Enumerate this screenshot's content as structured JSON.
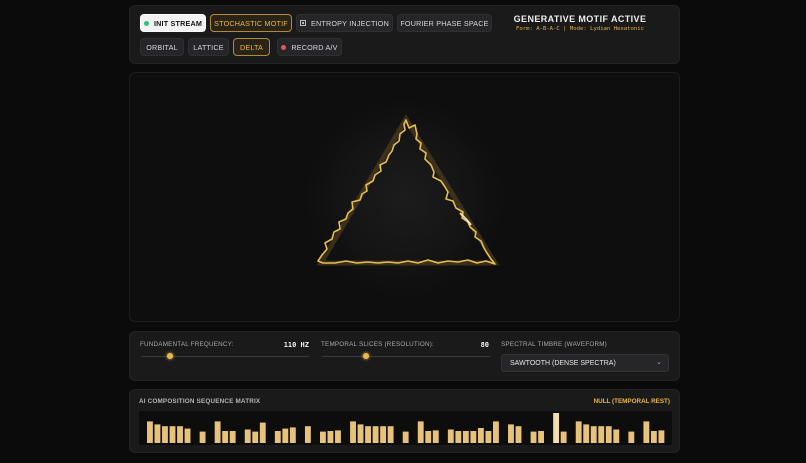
{
  "toolbar": {
    "row1": [
      {
        "label": "INIT STREAM",
        "style": "primary",
        "icon": "status-dot-icon"
      },
      {
        "label": "STOCHASTIC MOTIF",
        "style": "gold"
      },
      {
        "label": "ENTROPY INJECTION",
        "style": "normal",
        "icon": "square-icon"
      },
      {
        "label": "FOURIER PHASE SPACE",
        "style": "normal"
      }
    ],
    "row2": [
      {
        "label": "ORBITAL",
        "style": "normal"
      },
      {
        "label": "LATTICE",
        "style": "normal"
      },
      {
        "label": "DELTA",
        "style": "gold"
      },
      {
        "label": "RECORD A/V",
        "style": "normal",
        "icon": "record-dot-icon"
      }
    ],
    "status_title": "GENERATIVE MOTIF ACTIVE",
    "status_sub": "Form: A-B-A-C | Mode: Lydian Hexatonic"
  },
  "controls": {
    "frequency": {
      "label": "FUNDAMENTAL FREQUENCY:",
      "value": "110 HZ",
      "level": 0.17
    },
    "slices": {
      "label": "TEMPORAL SLICES (RESOLUTION):",
      "value": "80",
      "level": 0.26
    },
    "timbre": {
      "label": "SPECTRAL TIMBRE (WAVEFORM)",
      "value": "SAWTOOTH (DENSE SPECTRA)"
    }
  },
  "sequencer": {
    "title": "AI COMPOSITION SEQUENCE MATRIX",
    "status": "NULL (TEMPORAL REST)",
    "levels": [
      0.72,
      0.62,
      0.56,
      0.56,
      0.56,
      0.48,
      0,
      0.38,
      0,
      0.72,
      0.4,
      0.4,
      0,
      0.45,
      0.38,
      0.68,
      0,
      0.4,
      0.48,
      0.52,
      0,
      0.56,
      0,
      0.38,
      0.4,
      0.42,
      0,
      0.72,
      0.62,
      0.56,
      0.56,
      0.56,
      0.56,
      0,
      0.38,
      0,
      0.72,
      0.4,
      0.42,
      0,
      0.45,
      0.4,
      0.4,
      0.4,
      0.5,
      0.4,
      0.72,
      0,
      0.62,
      0.56,
      0,
      0.38,
      0.4,
      0,
      1.0,
      0.38,
      0,
      0.72,
      0.62,
      0.56,
      0.56,
      0.56,
      0.45,
      0,
      0.38,
      0,
      0.72,
      0.4,
      0.42
    ],
    "highlight_index": 54,
    "colors": {
      "bar": "#e6c27a",
      "highlight": "#f6ddb0"
    }
  },
  "colors": {
    "accent": "#e9b84d",
    "panel": "#1a1a1b",
    "background": "#0b0b0c"
  }
}
